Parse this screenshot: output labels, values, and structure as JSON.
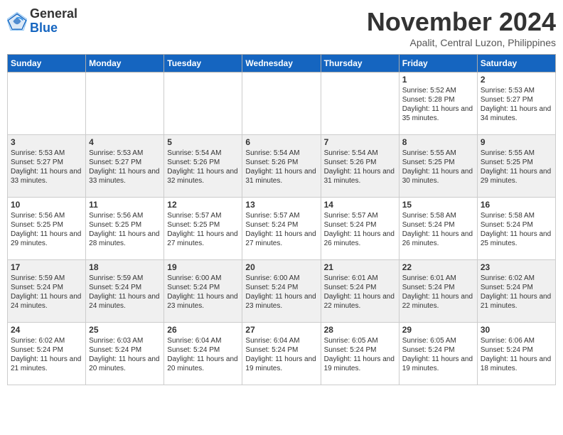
{
  "header": {
    "logo_general": "General",
    "logo_blue": "Blue",
    "month_title": "November 2024",
    "subtitle": "Apalit, Central Luzon, Philippines"
  },
  "weekdays": [
    "Sunday",
    "Monday",
    "Tuesday",
    "Wednesday",
    "Thursday",
    "Friday",
    "Saturday"
  ],
  "weeks": [
    [
      {
        "day": "",
        "info": ""
      },
      {
        "day": "",
        "info": ""
      },
      {
        "day": "",
        "info": ""
      },
      {
        "day": "",
        "info": ""
      },
      {
        "day": "",
        "info": ""
      },
      {
        "day": "1",
        "info": "Sunrise: 5:52 AM\nSunset: 5:28 PM\nDaylight: 11 hours and 35 minutes."
      },
      {
        "day": "2",
        "info": "Sunrise: 5:53 AM\nSunset: 5:27 PM\nDaylight: 11 hours and 34 minutes."
      }
    ],
    [
      {
        "day": "3",
        "info": "Sunrise: 5:53 AM\nSunset: 5:27 PM\nDaylight: 11 hours and 33 minutes."
      },
      {
        "day": "4",
        "info": "Sunrise: 5:53 AM\nSunset: 5:27 PM\nDaylight: 11 hours and 33 minutes."
      },
      {
        "day": "5",
        "info": "Sunrise: 5:54 AM\nSunset: 5:26 PM\nDaylight: 11 hours and 32 minutes."
      },
      {
        "day": "6",
        "info": "Sunrise: 5:54 AM\nSunset: 5:26 PM\nDaylight: 11 hours and 31 minutes."
      },
      {
        "day": "7",
        "info": "Sunrise: 5:54 AM\nSunset: 5:26 PM\nDaylight: 11 hours and 31 minutes."
      },
      {
        "day": "8",
        "info": "Sunrise: 5:55 AM\nSunset: 5:25 PM\nDaylight: 11 hours and 30 minutes."
      },
      {
        "day": "9",
        "info": "Sunrise: 5:55 AM\nSunset: 5:25 PM\nDaylight: 11 hours and 29 minutes."
      }
    ],
    [
      {
        "day": "10",
        "info": "Sunrise: 5:56 AM\nSunset: 5:25 PM\nDaylight: 11 hours and 29 minutes."
      },
      {
        "day": "11",
        "info": "Sunrise: 5:56 AM\nSunset: 5:25 PM\nDaylight: 11 hours and 28 minutes."
      },
      {
        "day": "12",
        "info": "Sunrise: 5:57 AM\nSunset: 5:25 PM\nDaylight: 11 hours and 27 minutes."
      },
      {
        "day": "13",
        "info": "Sunrise: 5:57 AM\nSunset: 5:24 PM\nDaylight: 11 hours and 27 minutes."
      },
      {
        "day": "14",
        "info": "Sunrise: 5:57 AM\nSunset: 5:24 PM\nDaylight: 11 hours and 26 minutes."
      },
      {
        "day": "15",
        "info": "Sunrise: 5:58 AM\nSunset: 5:24 PM\nDaylight: 11 hours and 26 minutes."
      },
      {
        "day": "16",
        "info": "Sunrise: 5:58 AM\nSunset: 5:24 PM\nDaylight: 11 hours and 25 minutes."
      }
    ],
    [
      {
        "day": "17",
        "info": "Sunrise: 5:59 AM\nSunset: 5:24 PM\nDaylight: 11 hours and 24 minutes."
      },
      {
        "day": "18",
        "info": "Sunrise: 5:59 AM\nSunset: 5:24 PM\nDaylight: 11 hours and 24 minutes."
      },
      {
        "day": "19",
        "info": "Sunrise: 6:00 AM\nSunset: 5:24 PM\nDaylight: 11 hours and 23 minutes."
      },
      {
        "day": "20",
        "info": "Sunrise: 6:00 AM\nSunset: 5:24 PM\nDaylight: 11 hours and 23 minutes."
      },
      {
        "day": "21",
        "info": "Sunrise: 6:01 AM\nSunset: 5:24 PM\nDaylight: 11 hours and 22 minutes."
      },
      {
        "day": "22",
        "info": "Sunrise: 6:01 AM\nSunset: 5:24 PM\nDaylight: 11 hours and 22 minutes."
      },
      {
        "day": "23",
        "info": "Sunrise: 6:02 AM\nSunset: 5:24 PM\nDaylight: 11 hours and 21 minutes."
      }
    ],
    [
      {
        "day": "24",
        "info": "Sunrise: 6:02 AM\nSunset: 5:24 PM\nDaylight: 11 hours and 21 minutes."
      },
      {
        "day": "25",
        "info": "Sunrise: 6:03 AM\nSunset: 5:24 PM\nDaylight: 11 hours and 20 minutes."
      },
      {
        "day": "26",
        "info": "Sunrise: 6:04 AM\nSunset: 5:24 PM\nDaylight: 11 hours and 20 minutes."
      },
      {
        "day": "27",
        "info": "Sunrise: 6:04 AM\nSunset: 5:24 PM\nDaylight: 11 hours and 19 minutes."
      },
      {
        "day": "28",
        "info": "Sunrise: 6:05 AM\nSunset: 5:24 PM\nDaylight: 11 hours and 19 minutes."
      },
      {
        "day": "29",
        "info": "Sunrise: 6:05 AM\nSunset: 5:24 PM\nDaylight: 11 hours and 19 minutes."
      },
      {
        "day": "30",
        "info": "Sunrise: 6:06 AM\nSunset: 5:24 PM\nDaylight: 11 hours and 18 minutes."
      }
    ]
  ]
}
